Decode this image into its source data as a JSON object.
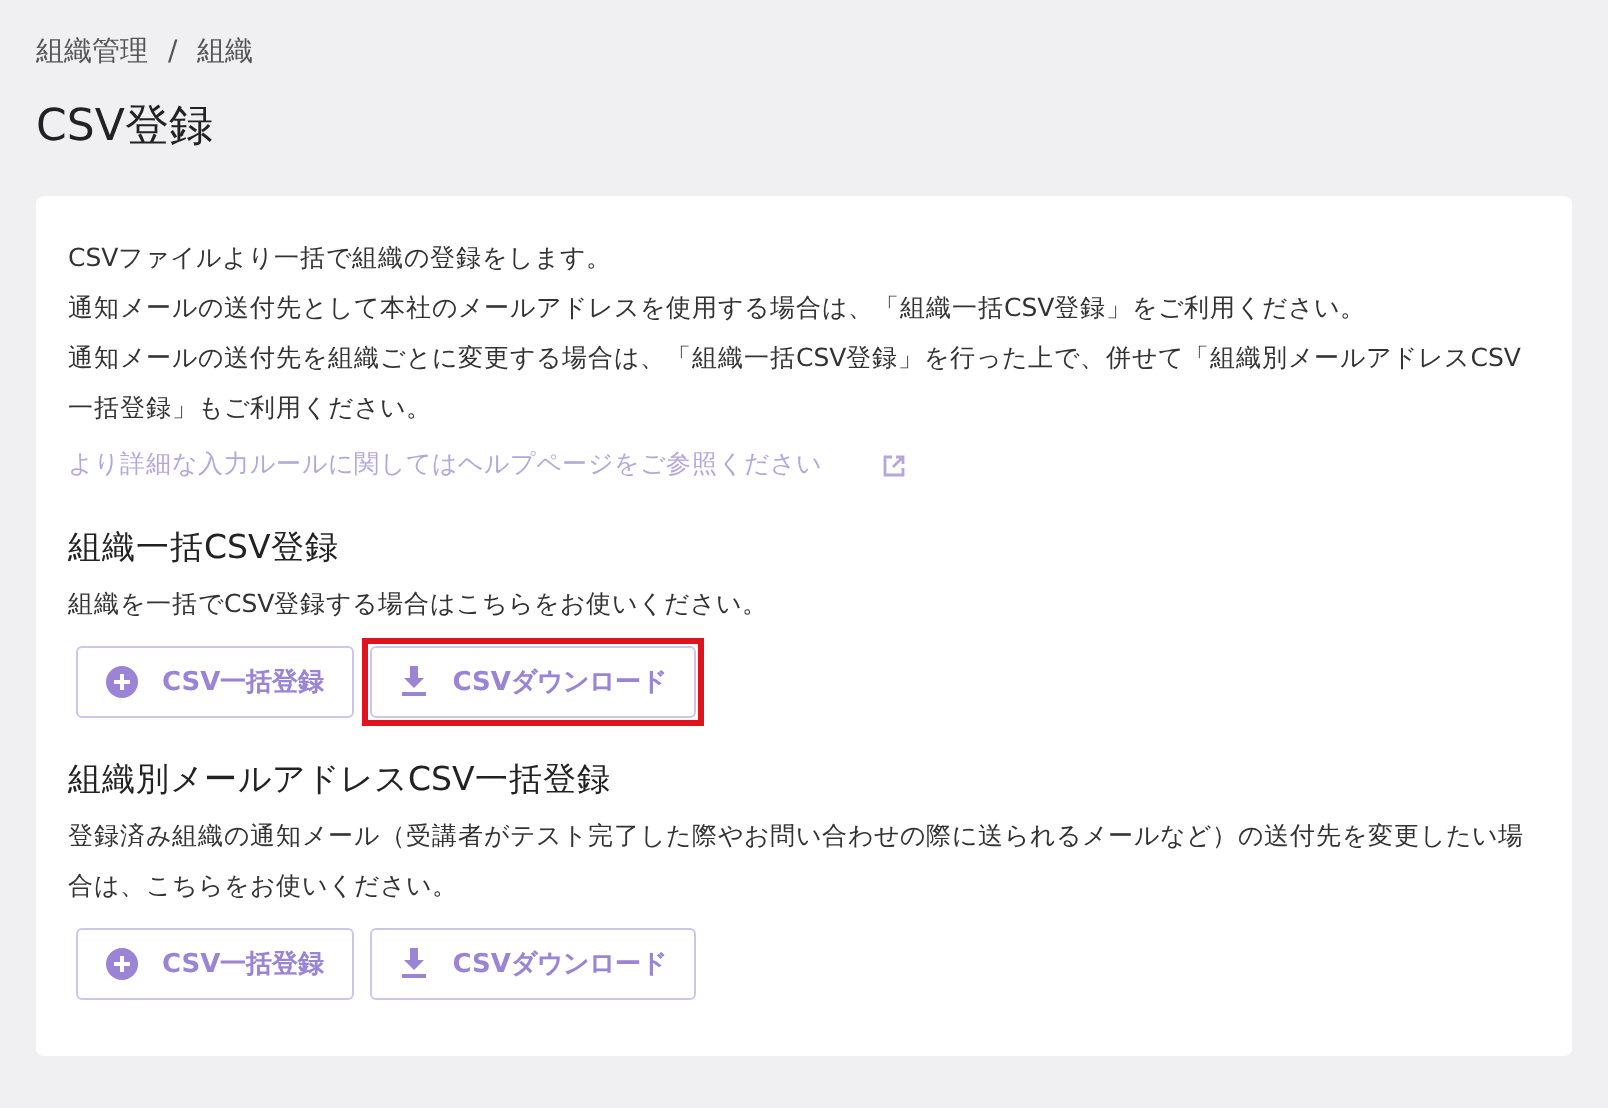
{
  "breadcrumb": [
    "組織管理",
    "組織"
  ],
  "breadcrumb_separator": "/",
  "title": "CSV登録",
  "intro": [
    "CSVファイルより一括で組織の登録をします。",
    "通知メールの送付先として本社のメールアドレスを使用する場合は、「組織一括CSV登録」をご利用ください。",
    "通知メールの送付先を組織ごとに変更する場合は、「組織一括CSV登録」を行った上で、併せて「組織別メールアドレスCSV一括登録」もご利用ください。"
  ],
  "help_link": "より詳細な入力ルールに関してはヘルプページをご参照ください",
  "sections": [
    {
      "heading": "組織一括CSV登録",
      "description": "組織を一括でCSV登録する場合はこちらをお使いください。",
      "buttons": [
        {
          "kind": "upload",
          "label": "CSV一括登録",
          "highlighted": false
        },
        {
          "kind": "download",
          "label": "CSVダウンロード",
          "highlighted": true
        }
      ]
    },
    {
      "heading": "組織別メールアドレスCSV一括登録",
      "description": "登録済み組織の通知メール（受講者がテスト完了した際やお問い合わせの際に送られるメールなど）の送付先を変更したい場合は、こちらをお使いください。",
      "buttons": [
        {
          "kind": "upload",
          "label": "CSV一括登録",
          "highlighted": false
        },
        {
          "kind": "download",
          "label": "CSVダウンロード",
          "highlighted": false
        }
      ]
    }
  ]
}
